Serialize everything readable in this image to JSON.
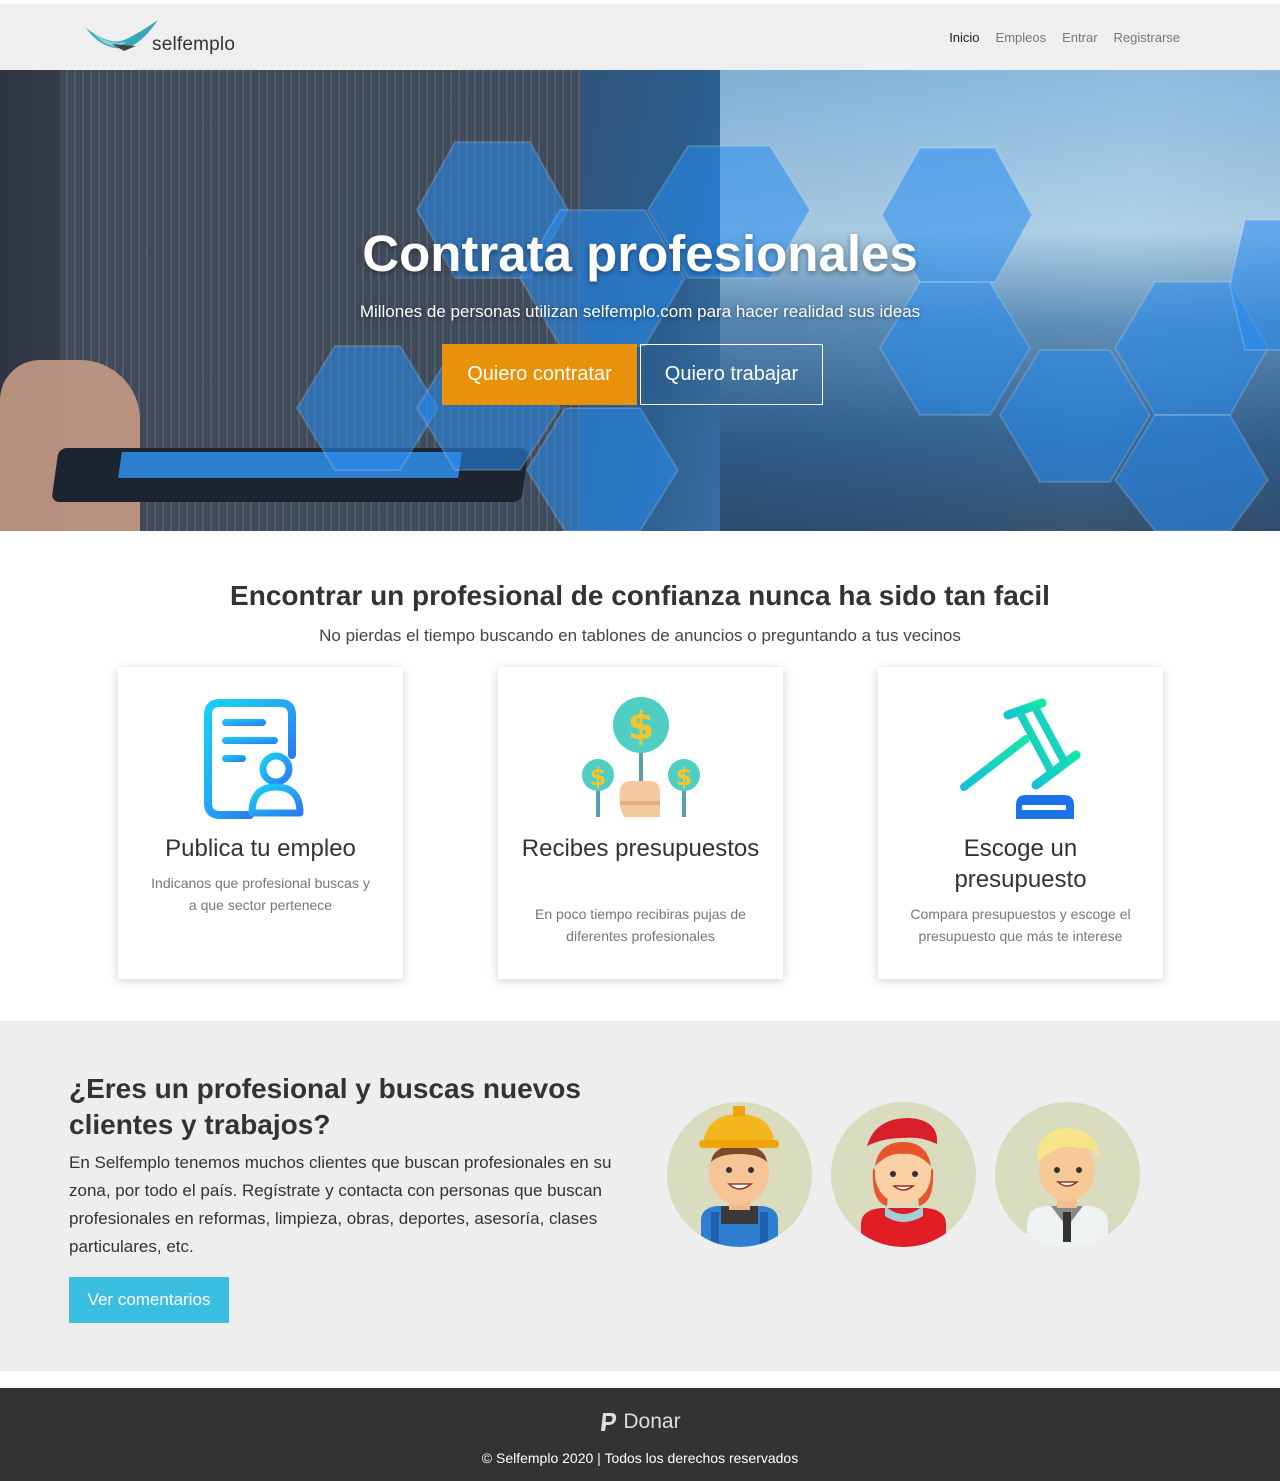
{
  "brand": {
    "name": "selfemplo"
  },
  "nav": {
    "items": [
      {
        "label": "Inicio",
        "active": true
      },
      {
        "label": "Empleos",
        "active": false
      },
      {
        "label": "Entrar",
        "active": false
      },
      {
        "label": "Registrarse",
        "active": false
      }
    ]
  },
  "hero": {
    "title": "Contrata profesionales",
    "subtitle": "Millones de personas utilizan selfemplo.com para hacer realidad sus ideas",
    "primary_button": "Quiero contratar",
    "secondary_button": "Quiero trabajar"
  },
  "how": {
    "title": "Encontrar un profesional de confianza nunca ha sido tan facil",
    "subtitle": "No pierdas el tiempo buscando en tablones de anuncios o preguntando a tus vecinos",
    "cards": [
      {
        "icon": "resume-icon",
        "title": "Publica tu empleo",
        "text": "Indicanos que profesional buscas y a que sector pertenece"
      },
      {
        "icon": "money-hand-icon",
        "title": "Recibes presupuestos",
        "text": "En poco tiempo recibiras pujas de diferentes profesionales"
      },
      {
        "icon": "gavel-icon",
        "title": "Escoge un presupuesto",
        "text": "Compara presupuestos y escoge el presupuesto que más te interese"
      }
    ]
  },
  "pros": {
    "title": "¿Eres un profesional y buscas nuevos clientes y trabajos?",
    "text": "En Selfemplo tenemos muchos clientes que buscan profesionales en su zona, por todo el país. Regístrate y contacta con personas que buscan profesionales en reformas, limpieza, obras, deportes, asesoría, clases particulares, etc.",
    "button": "Ver comentarios",
    "avatars": [
      "construction-worker-avatar",
      "woman-beret-avatar",
      "doctor-avatar"
    ]
  },
  "footer": {
    "donate": "Donar",
    "copyright": "© Selfemplo 2020 | Todos los derechos reservados"
  },
  "colors": {
    "accent_orange": "#e8920c",
    "accent_cyan": "#3bbfe0",
    "footer_bg": "#333333",
    "section_bg": "#eeeeee"
  }
}
